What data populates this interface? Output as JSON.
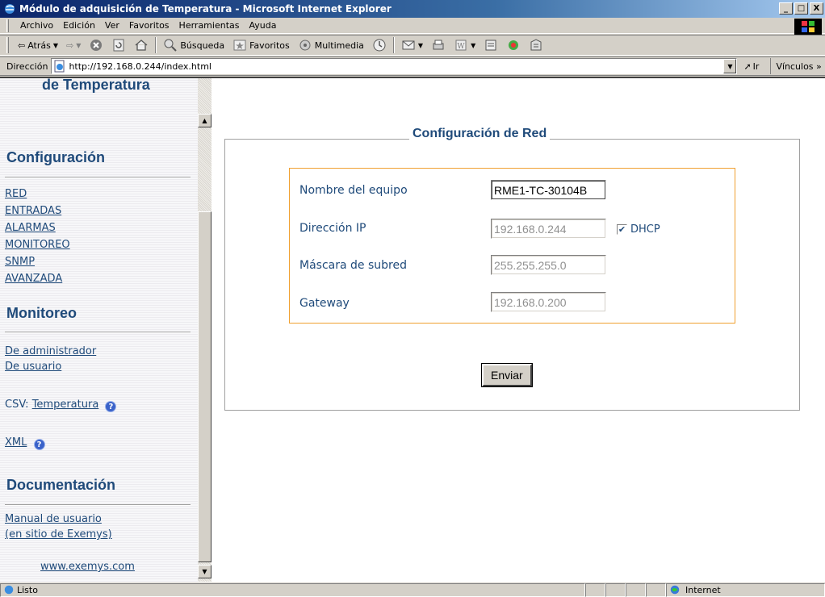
{
  "window": {
    "title": "Módulo de adquisición de Temperatura - Microsoft Internet Explorer",
    "buttons": [
      "_",
      "□",
      "X"
    ]
  },
  "menubar": {
    "items": [
      "Archivo",
      "Edición",
      "Ver",
      "Favoritos",
      "Herramientas",
      "Ayuda"
    ]
  },
  "toolbar": {
    "back_label": "Atrás",
    "search_label": "Búsqueda",
    "favorites_label": "Favoritos",
    "multimedia_label": "Multimedia"
  },
  "addressbar": {
    "label": "Dirección",
    "url": "http://192.168.0.244/index.html",
    "go_label": "Ir",
    "links_label": "Vínculos »"
  },
  "sidebar": {
    "partial_title": "de Temperatura",
    "config_heading": "Configuración",
    "config_links": [
      "RED",
      "ENTRADAS",
      "ALARMAS",
      "MONITOREO",
      "SNMP",
      "AVANZADA"
    ],
    "monitor_heading": "Monitoreo",
    "monitor_links": [
      "De administrador",
      "De usuario"
    ],
    "csv_prefix": "CSV:",
    "csv_link": "Temperatura",
    "xml_link": "XML",
    "doc_heading": "Documentación",
    "doc_link_line1": "Manual de usuario",
    "doc_link_line2": "(en sitio de Exemys)",
    "footer_link": "www.exemys.com"
  },
  "form": {
    "legend": "Configuración de Red",
    "hostname_label": "Nombre del equipo",
    "hostname_value": "RME1-TC-30104B",
    "ip_label": "Dirección IP",
    "ip_value": "192.168.0.244",
    "dhcp_label": "DHCP",
    "dhcp_checked": true,
    "mask_label": "Máscara de subred",
    "mask_value": "255.255.255.0",
    "gateway_label": "Gateway",
    "gateway_value": "192.168.0.200",
    "submit_label": "Enviar"
  },
  "statusbar": {
    "text": "Listo",
    "zone": "Internet"
  },
  "colors": {
    "heading": "#1f4a7a",
    "box_border": "#f0a030",
    "titlebar": "#0a246a"
  }
}
